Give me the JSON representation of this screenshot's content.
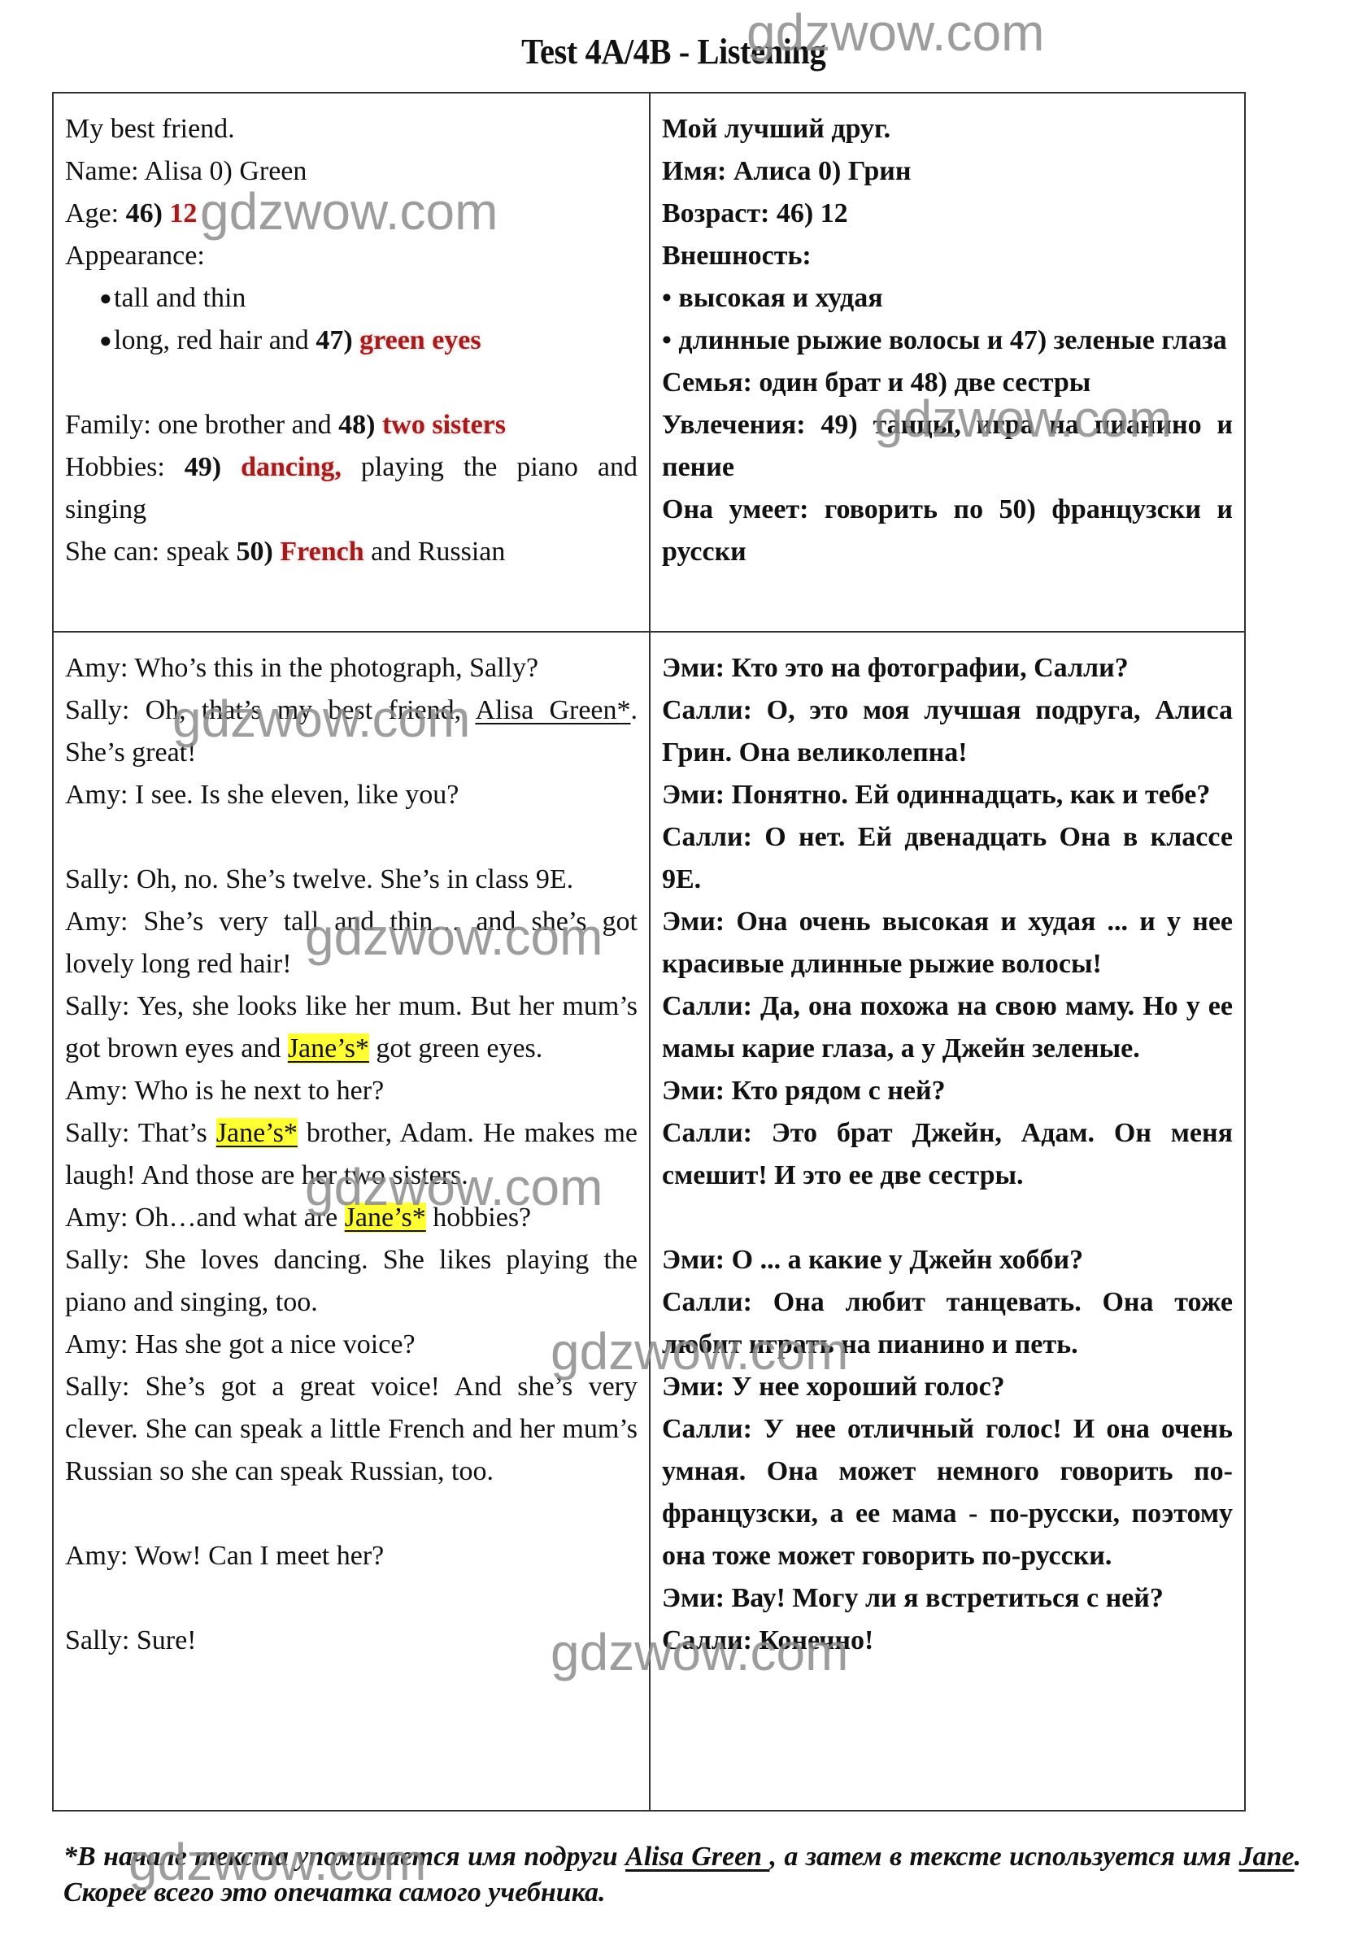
{
  "title": "Test 4A/4B - Listening",
  "watermark": "gdzwow.com",
  "profile_en": {
    "heading": "My best friend.",
    "name_label": "Name: Alisa 0) Green",
    "age_label": "Age: ",
    "age_num": "46)",
    "age_answer": "12",
    "appearance_label": "Appearance:",
    "bullet1": "tall and thin",
    "bullet2_pre": "long, red hair and ",
    "bullet2_num": "47)",
    "bullet2_answer": "green eyes",
    "family_pre": "Family: one brother and ",
    "family_num": "48)",
    "family_answer": "two sisters",
    "hobbies_pre": "Hobbies: ",
    "hobbies_num": "49)",
    "hobbies_answer": "dancing,",
    "hobbies_post": " playing the piano and singing",
    "can_pre": "She can: speak ",
    "can_num": "50)",
    "can_answer": "French",
    "can_post": " and Russian"
  },
  "profile_ru": {
    "heading": "Мой лучший друг.",
    "name": "Имя: Алиса 0) Грин",
    "age": "Возраст: 46) 12",
    "appearance": "Внешность:",
    "bullet1": "• высокая и худая",
    "bullet2": "• длинные рыжие волосы и 47) зеленые глаза",
    "family": "Семья: один брат и 48) две сестры",
    "hobbies": "Увлечения: 49) танцы, игра на пианино и пение",
    "can": "Она умеет: говорить по 50) французски и русски"
  },
  "dialogue_en": {
    "l1": "Amy: Who’s this in the photograph, Sally?",
    "l2_pre": "Sally: Oh, that’s my best friend, ",
    "l2_name": "Alisa Green*",
    "l2_post": ". She’s great!",
    "l3": "Amy: I see. Is she eleven, like you?",
    "l4": "Sally: Oh, no. She’s twelve. She’s in class 9E.",
    "l5": "Amy: She’s very tall and thin… and she’s got lovely long red hair!",
    "l6_pre": "Sally: Yes, she looks like her mum. But her mum’s got brown eyes and ",
    "l6_name": "Jane’s*",
    "l6_post": " got green eyes.",
    "l7": "Amy: Who is he next to her?",
    "l8_pre": "Sally: That’s ",
    "l8_name": "Jane’s*",
    "l8_post": " brother, Adam. He makes me laugh! And those are her two sisters.",
    "l9_pre": "Amy: Oh…and what are ",
    "l9_name": "Jane’s*",
    "l9_post": " hobbies?",
    "l10": "Sally: She loves dancing. She likes playing the piano and singing, too.",
    "l11": "Amy: Has she got a nice voice?",
    "l12": "Sally: She’s got a great voice! And she’s very clever. She can speak a little French and her mum’s Russian so she can speak Russian, too.",
    "l13": "Amy: Wow! Can I meet her?",
    "l14": "Sally: Sure!"
  },
  "dialogue_ru": {
    "l1": "Эми: Кто это на фотографии, Салли?",
    "l2": "Салли: О, это моя лучшая подруга, Алиса Грин. Она великолепна!",
    "l3": "Эми: Понятно. Ей одиннадцать, как и тебе?",
    "l4": "Салли: О нет. Ей двенадцать Она в классе 9Е.",
    "l5": "Эми: Она очень высокая и худая ... и у нее красивые длинные рыжие волосы!",
    "l6": "Салли: Да, она похожа на свою маму. Но у ее мамы карие глаза, а у Джейн зеленые.",
    "l7": "Эми: Кто рядом с ней?",
    "l8": "Салли: Это брат Джейн, Адам. Он меня смешит! И это ее две сестры.",
    "l9": "Эми: О ... а какие у Джейн хобби?",
    "l10": "Салли: Она любит танцевать. Она тоже любит играть на пианино и петь.",
    "l11": "Эми: У нее хороший голос?",
    "l12": "Салли: У нее отличный голос! И она очень умная. Она может немного говорить по-французски, а ее мама - по-русски, поэтому она тоже может говорить по-русски.",
    "l13": "Эми: Вау! Могу ли я встретиться с ней?",
    "l14": "Салли: Конечно!"
  },
  "footnote": {
    "pre": "*В начале текста  упоминается имя подруги ",
    "name1": "Alisa Green ",
    "mid": ", а затем в тексте используется имя ",
    "name2": "Jane",
    "post": ". Скорее всего это опечатка самого учебника."
  },
  "colors": {
    "answer": "#a31b1b",
    "highlight": "#ffff33",
    "watermark": "#8c8c8c"
  }
}
